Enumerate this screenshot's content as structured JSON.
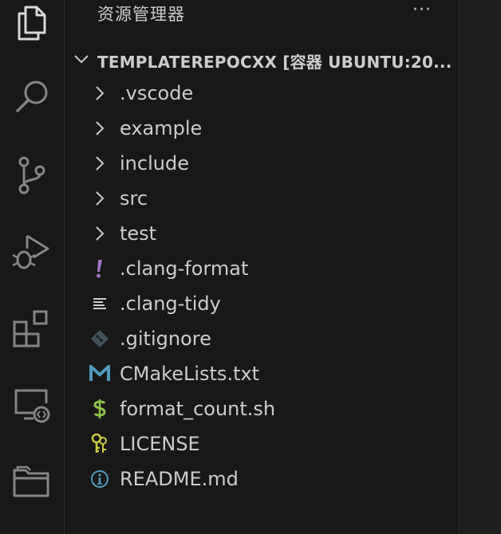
{
  "sidebar": {
    "title": "资源管理器",
    "more_label": "···"
  },
  "section": {
    "title": "TEMPLATEREPOCXX [容器 UBUNTU:20..."
  },
  "tree": [
    {
      "label": ".vscode",
      "kind": "folder",
      "icon": "chevron-right-icon"
    },
    {
      "label": "example",
      "kind": "folder",
      "icon": "chevron-right-icon"
    },
    {
      "label": "include",
      "kind": "folder",
      "icon": "chevron-right-icon"
    },
    {
      "label": "src",
      "kind": "folder",
      "icon": "chevron-right-icon"
    },
    {
      "label": "test",
      "kind": "folder",
      "icon": "chevron-right-icon"
    },
    {
      "label": ".clang-format",
      "kind": "file",
      "icon": "exclamation-icon",
      "color": "#a074c4"
    },
    {
      "label": ".clang-tidy",
      "kind": "file",
      "icon": "lines-icon",
      "color": "#cccccc"
    },
    {
      "label": ".gitignore",
      "kind": "file",
      "icon": "git-icon",
      "color": "#41535b"
    },
    {
      "label": "CMakeLists.txt",
      "kind": "file",
      "icon": "m-icon",
      "color": "#519aba"
    },
    {
      "label": "format_count.sh",
      "kind": "file",
      "icon": "dollar-icon",
      "color": "#8dc149"
    },
    {
      "label": "LICENSE",
      "kind": "file",
      "icon": "key-icon",
      "color": "#cbcb41"
    },
    {
      "label": "README.md",
      "kind": "file",
      "icon": "info-icon",
      "color": "#519aba"
    }
  ],
  "activity_bar": [
    {
      "icon": "explorer-icon"
    },
    {
      "icon": "search-icon"
    },
    {
      "icon": "source-control-icon"
    },
    {
      "icon": "run-debug-icon"
    },
    {
      "icon": "extensions-icon"
    },
    {
      "icon": "remote-explorer-icon"
    },
    {
      "icon": "folder-icon"
    }
  ],
  "colors": {
    "background": "#181818",
    "foreground": "#cccccc",
    "icon_inactive": "#858585",
    "icon_active": "#d7d7d7"
  }
}
